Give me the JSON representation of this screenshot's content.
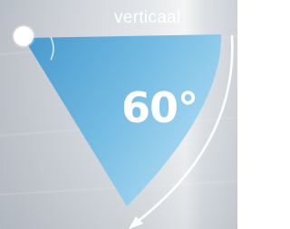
{
  "overlay": {
    "direction_label": "verticaal",
    "angle_value": "60°"
  },
  "icons": {
    "pivot": "pivot-dot-icon",
    "arrow": "rotation-arrow-icon"
  },
  "colors": {
    "sector_light": "#a6d8f1",
    "sector_dark": "#3a93cb",
    "background": "#d4d8dd",
    "text": "#ffffff"
  }
}
